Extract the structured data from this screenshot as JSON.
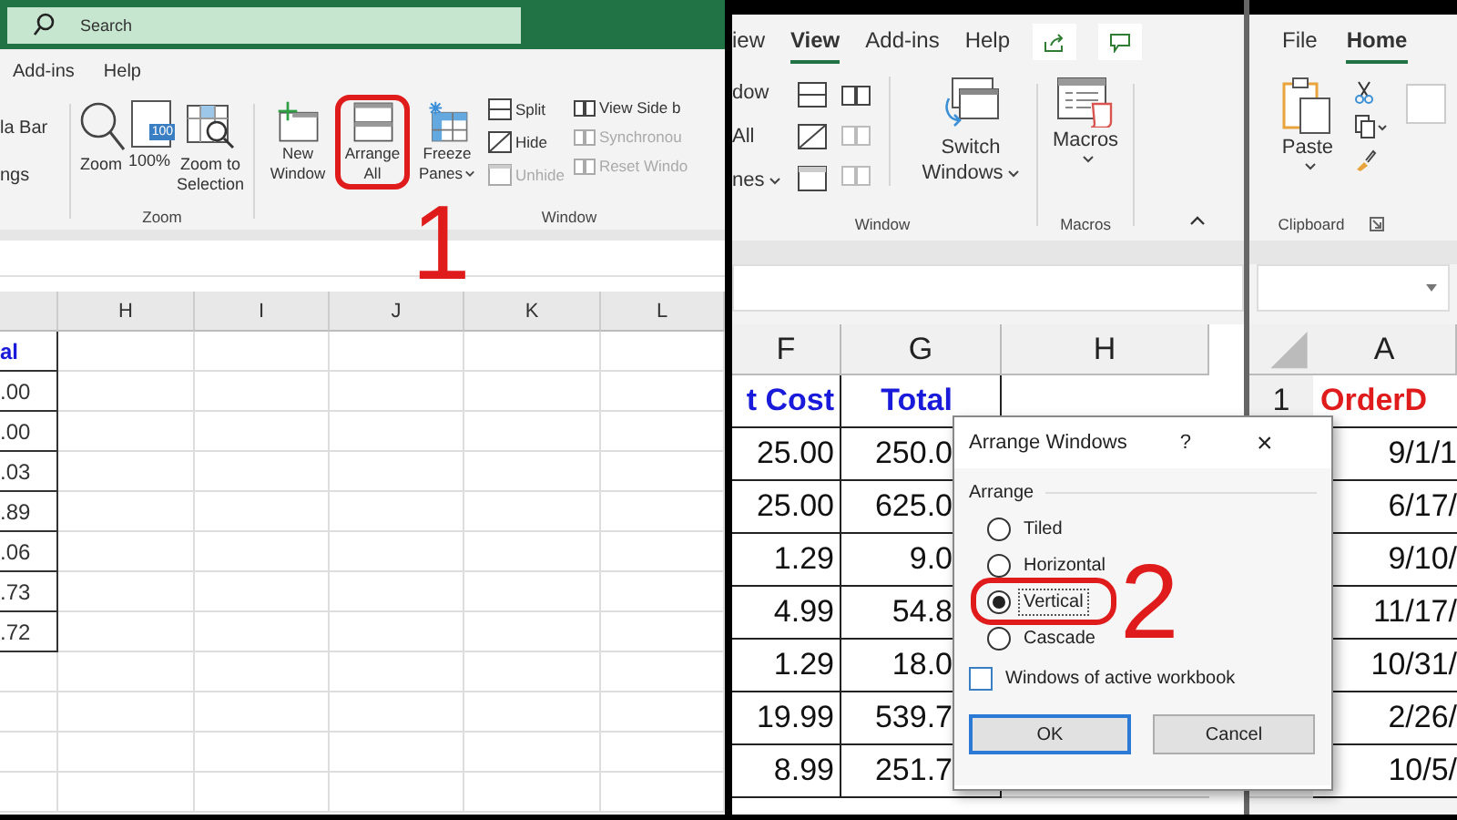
{
  "left": {
    "search": {
      "placeholder": "Search"
    },
    "tabs": [
      "Add-ins",
      "Help"
    ],
    "show_group": [
      "la Bar",
      "ngs"
    ],
    "zoom_group": {
      "label": "Zoom",
      "buttons": [
        {
          "label": "Zoom"
        },
        {
          "label": "100%",
          "badge": "100"
        },
        {
          "label": "Zoom to Selection"
        }
      ]
    },
    "window_group": {
      "label": "Window",
      "large_buttons": [
        {
          "label": "New Window",
          "dropdown": false,
          "highlighted": false
        },
        {
          "label": "Arrange All",
          "dropdown": false,
          "highlighted": true
        },
        {
          "label": "Freeze Panes",
          "dropdown": true,
          "highlighted": false
        }
      ],
      "small_buttons": [
        {
          "label": "Split",
          "disabled": false
        },
        {
          "label": "Hide",
          "disabled": false
        },
        {
          "label": "Unhide",
          "disabled": true
        }
      ],
      "side_buttons": [
        {
          "label": "View Side b",
          "disabled": false
        },
        {
          "label": "Synchronou",
          "disabled": true
        },
        {
          "label": "Reset Windo",
          "disabled": true
        }
      ]
    },
    "callout": "1",
    "columns": [
      "H",
      "I",
      "J",
      "K",
      "L"
    ],
    "column_1_cells": [
      "al",
      ".00",
      ".00",
      ".03",
      ".89",
      ".06",
      ".73",
      ".72"
    ]
  },
  "right": {
    "tabs": [
      {
        "label": "iew",
        "selected": false
      },
      {
        "label": "View",
        "selected": true
      },
      {
        "label": "Add-ins",
        "selected": false
      },
      {
        "label": "Help",
        "selected": false
      }
    ],
    "window_group": {
      "label": "Window",
      "cut_labels": [
        {
          "label": "dow",
          "dropdown": false
        },
        {
          "label": "All",
          "dropdown": false
        },
        {
          "label": "nes",
          "dropdown": true
        }
      ],
      "small_disabled": [
        false,
        false,
        false,
        false,
        true,
        true
      ]
    },
    "switch_windows": {
      "label": "Switch Windows",
      "dropdown": true
    },
    "macros_group": {
      "label": "Macros",
      "button": "Macros",
      "dropdown": true
    },
    "columns": [
      "F",
      "G",
      "H"
    ],
    "rows": [
      [
        "t Cost",
        "Total"
      ],
      [
        "25.00",
        "250.0"
      ],
      [
        "25.00",
        "625.0"
      ],
      [
        "1.29",
        "9.0"
      ],
      [
        "4.99",
        "54.8"
      ],
      [
        "1.29",
        "18.0"
      ],
      [
        "19.99",
        "539.7"
      ],
      [
        "8.99",
        "251.7"
      ]
    ],
    "second_window": {
      "tabs": [
        {
          "label": "File",
          "selected": false
        },
        {
          "label": "Home",
          "selected": true
        }
      ],
      "paste": {
        "label": "Paste",
        "dropdown": true
      },
      "clipboard_label": "Clipboard",
      "column": "A",
      "row_number": "1",
      "cells": [
        "OrderD",
        "9/1/1",
        "6/17/",
        "9/10/",
        "11/17/",
        "10/31/",
        "2/26/",
        "10/5/"
      ]
    },
    "dialog": {
      "title": "Arrange Windows",
      "help": "?",
      "close": "×",
      "group": "Arrange",
      "options": [
        {
          "label": "Tiled",
          "selected": false,
          "highlighted": false
        },
        {
          "label": "Horizontal",
          "selected": false,
          "highlighted": false
        },
        {
          "label": "Vertical",
          "selected": true,
          "highlighted": true
        },
        {
          "label": "Cascade",
          "selected": false,
          "highlighted": false
        }
      ],
      "checkbox": {
        "label": "Windows of active workbook",
        "checked": false
      },
      "buttons": [
        {
          "label": "OK",
          "default": true
        },
        {
          "label": "Cancel",
          "default": false
        }
      ]
    },
    "callout": "2"
  }
}
